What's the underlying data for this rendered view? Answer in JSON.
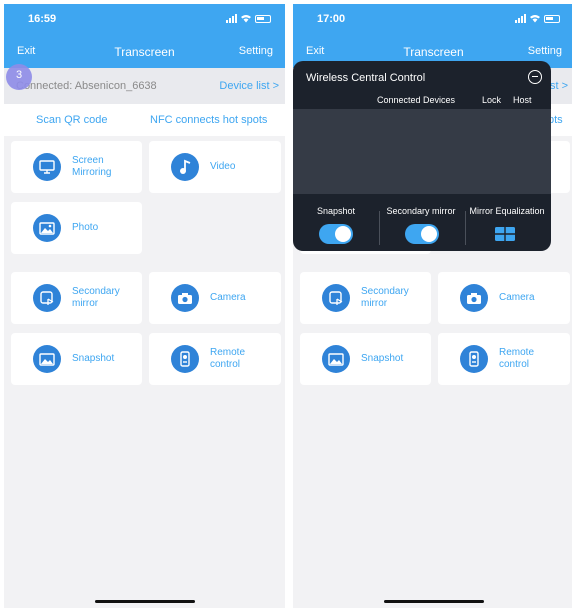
{
  "left_screen": {
    "status": {
      "time": "16:59"
    },
    "nav": {
      "exit": "Exit",
      "title": "Transcreen",
      "setting": "Setting"
    },
    "badge": "3",
    "connection": {
      "text": "Connected: Absenicon_6638",
      "device_list": "Device list >"
    },
    "links": {
      "scan": "Scan QR code",
      "nfc": "NFC connects hot spots"
    },
    "cards": [
      {
        "line1": "Screen",
        "line2": "Mirroring",
        "icon": "monitor-icon"
      },
      {
        "line1": "Video",
        "line2": "",
        "icon": "music-note-icon"
      },
      {
        "line1": "Photo",
        "line2": "",
        "icon": "photo-icon"
      },
      {
        "line1": "Secondary",
        "line2": "mirror",
        "icon": "secondary-mirror-icon"
      },
      {
        "line1": "Camera",
        "line2": "",
        "icon": "camera-icon"
      },
      {
        "line1": "Snapshot",
        "line2": "",
        "icon": "snapshot-icon"
      },
      {
        "line1": "Remote",
        "line2": "control",
        "icon": "remote-icon"
      }
    ]
  },
  "right_screen": {
    "status": {
      "time": "17:00"
    },
    "nav": {
      "exit": "Exit",
      "title": "Transcreen",
      "setting": "Setting"
    },
    "peek": {
      "device_list": "st >",
      "nfc": "pts"
    },
    "popup": {
      "title": "Wireless Central Control",
      "headers": [
        "Connected Devices",
        "Lock",
        "Host"
      ],
      "toggles": [
        {
          "label": "Snapshot",
          "on": true
        },
        {
          "label": "Secondary mirror",
          "on": true
        },
        {
          "label": "Mirror Equalization",
          "icon": "grid-icon"
        }
      ]
    },
    "cards": [
      {
        "line1": "Secondary",
        "line2": "mirror",
        "icon": "secondary-mirror-icon"
      },
      {
        "line1": "Camera",
        "line2": "",
        "icon": "camera-icon"
      },
      {
        "line1": "Snapshot",
        "line2": "",
        "icon": "snapshot-icon"
      },
      {
        "line1": "Remote",
        "line2": "control",
        "icon": "remote-icon"
      }
    ]
  },
  "colors": {
    "accent": "#3ea6f1",
    "icon_bg": "#2f83d8",
    "popup_bg": "#1c222c",
    "panel": "#353b46"
  }
}
